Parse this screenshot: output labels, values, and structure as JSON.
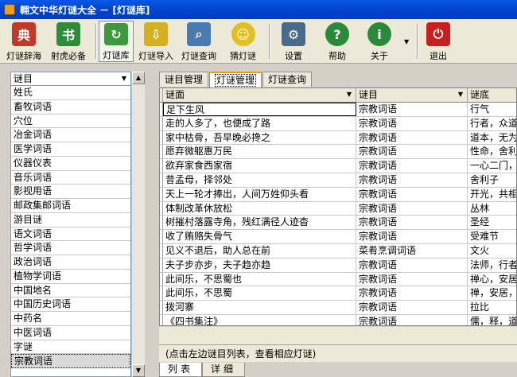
{
  "window": {
    "title": "翱文中华灯谜大全 － [灯谜库]"
  },
  "toolbar": {
    "buttons": [
      {
        "id": "b1",
        "label": "灯谜辞海",
        "icon": "book-stack-icon",
        "color": "#c0392b"
      },
      {
        "id": "b2",
        "label": "射虎必备",
        "icon": "green-book-icon",
        "color": "#2e8b3a"
      },
      {
        "id": "b3",
        "label": "灯谜库",
        "icon": "refresh-arrow-icon",
        "color": "#3c9a3c"
      },
      {
        "id": "b4",
        "label": "灯谜导入",
        "icon": "import-cylinder-icon",
        "color": "#d4b020"
      },
      {
        "id": "b5",
        "label": "灯谜查询",
        "icon": "magnifier-icon",
        "color": "#4a7ab0"
      },
      {
        "id": "b6",
        "label": "猜灯谜",
        "icon": "smiley-icon",
        "color": "#e0c020"
      },
      {
        "id": "b7",
        "label": "设置",
        "icon": "gear-icon",
        "color": "#4a6a8a"
      },
      {
        "id": "b8",
        "label": "帮助",
        "icon": "help-question-icon",
        "color": "#2a8a3a"
      },
      {
        "id": "b9",
        "label": "关于",
        "icon": "info-icon",
        "color": "#2a8a3a"
      },
      {
        "id": "b10",
        "label": "退出",
        "icon": "power-exit-icon",
        "color": "#c82020"
      }
    ]
  },
  "left": {
    "combo_value": "谜目",
    "items": [
      "姓氏",
      "畜牧词语",
      "穴位",
      "冶金词语",
      "医学词语",
      "仪器仪表",
      "音乐词语",
      "影视用语",
      "邮政集邮词语",
      "游目谜",
      "语文词语",
      "哲学词语",
      "政治词语",
      "植物学词语",
      "中国地名",
      "中国历史词语",
      "中药名",
      "中医词语",
      "字谜",
      "宗教词语"
    ],
    "selected_index": 19
  },
  "tabs": [
    "谜目管理",
    "灯谜管理",
    "灯谜查询"
  ],
  "active_tab": 1,
  "grid": {
    "columns": [
      "谜面",
      "谜目",
      "谜底"
    ],
    "rows": [
      [
        "足下生风",
        "宗教词语",
        "行气"
      ],
      [
        "走的人多了，也便成了路",
        "宗教词语",
        "行者，众道"
      ],
      [
        "家中枯骨，吾早晚必搀之",
        "宗教词语",
        "道本，无为"
      ],
      [
        "愿弃微躯惠万民",
        "宗教词语",
        "性命，舍利"
      ],
      [
        "欲弃家食西家宿",
        "宗教词语",
        "一心二门，"
      ],
      [
        "昔孟母，择邻处",
        "宗教词语",
        "舍利子"
      ],
      [
        "天上一轮才捧出，人间万姓仰头看",
        "宗教词语",
        "开光，共相"
      ],
      [
        "体制改革休放松",
        "宗教词语",
        "丛林"
      ],
      [
        "树摧村落露寺角，残红满径人迹杳",
        "宗教词语",
        "圣经"
      ],
      [
        "收了贿赂失骨气",
        "宗教词语",
        "受难节"
      ],
      [
        "见义不退后，助人总在前",
        "菜肴烹调词语",
        "文火"
      ],
      [
        "夫子步亦步，夫子趋亦趋",
        "宗教词语",
        "法师，行者"
      ],
      [
        "此间乐，不思蜀也",
        "宗教词语",
        "禅心，安居"
      ],
      [
        "此间乐，不思蜀",
        "宗教词语",
        "禅，安居，"
      ],
      [
        "拨河寨",
        "宗教词语",
        "拉比"
      ],
      [
        "《四书集注》",
        "宗教词语",
        "儒，释，道"
      ]
    ]
  },
  "hint": "(点击左边谜目列表，查看相应灯谜)",
  "bottom_tabs": [
    "列表",
    "详细"
  ]
}
